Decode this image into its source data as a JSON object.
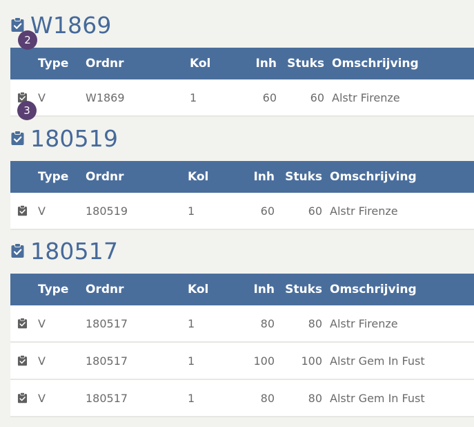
{
  "colors": {
    "header_bg": "#4a6e9c",
    "title": "#46699a",
    "icon": "#555555",
    "badge": "#5a3f72",
    "page_bg": "#f2f3ee"
  },
  "columns": {
    "type": "Type",
    "ordnr": "Ordnr",
    "kol": "Kol",
    "inh": "Inh",
    "stuks": "Stuks",
    "omschrijving": "Omschrijving"
  },
  "badges": [
    "2",
    "3"
  ],
  "orders": [
    {
      "title": "W1869",
      "icon": "clipboard-check-icon",
      "rows": [
        {
          "type": "V",
          "ordnr": "W1869",
          "kol": "1",
          "inh": "60",
          "stuks": "60",
          "omschrijving": "Alstr Firenze"
        }
      ]
    },
    {
      "title": "180519",
      "icon": "clipboard-check-icon",
      "rows": [
        {
          "type": "V",
          "ordnr": "180519",
          "kol": "1",
          "inh": "60",
          "stuks": "60",
          "omschrijving": "Alstr Firenze"
        }
      ]
    },
    {
      "title": "180517",
      "icon": "clipboard-check-icon",
      "rows": [
        {
          "type": "V",
          "ordnr": "180517",
          "kol": "1",
          "inh": "80",
          "stuks": "80",
          "omschrijving": "Alstr Firenze"
        },
        {
          "type": "V",
          "ordnr": "180517",
          "kol": "1",
          "inh": "100",
          "stuks": "100",
          "omschrijving": "Alstr Gem In Fust"
        },
        {
          "type": "V",
          "ordnr": "180517",
          "kol": "1",
          "inh": "80",
          "stuks": "80",
          "omschrijving": "Alstr Gem In Fust"
        }
      ]
    }
  ]
}
